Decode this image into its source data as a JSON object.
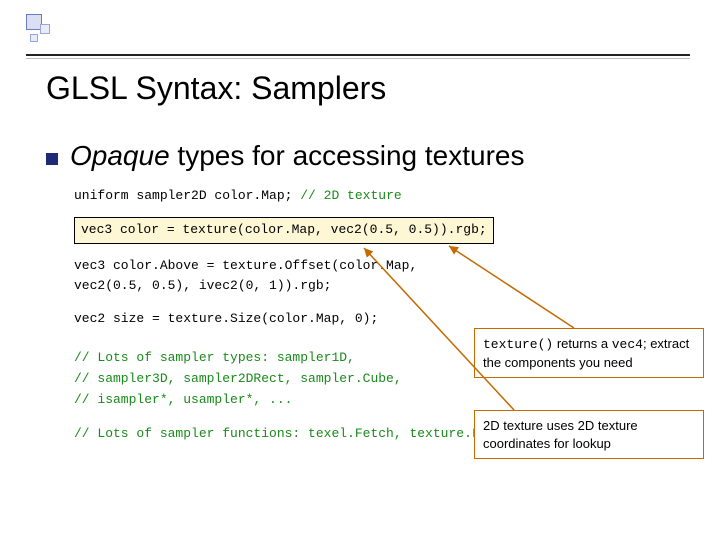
{
  "title": "GLSL Syntax:  Samplers",
  "bullet": {
    "italic": "Opaque",
    "rest": " types for accessing textures"
  },
  "code": {
    "l1": "uniform sampler2D color.Map; ",
    "l1_comment": "// 2D texture",
    "hl": "vec3 color = texture(color.Map, vec2(0.5, 0.5)).rgb;",
    "l2a": "vec3 color.Above = texture.Offset(color.Map,",
    "l2b": "  vec2(0.5, 0.5), ivec2(0, 1)).rgb;",
    "l3": "vec2 size = texture.Size(color.Map, 0);",
    "l4a_comment": "// Lots of sampler types:  sampler1D,",
    "l4b_comment": "// sampler3D, sampler2DRect, sampler.Cube,",
    "l4c_comment": "// isampler*, usampler*, ...",
    "l5_comment": "// Lots of sampler functions: texel.Fetch, texture.Lod"
  },
  "callout1": {
    "pre": "",
    "code1": "texture()",
    "mid": " returns a ",
    "code2": "vec4",
    "post": "; extract the components you need"
  },
  "callout2": "2D texture uses 2D texture coordinates for lookup"
}
